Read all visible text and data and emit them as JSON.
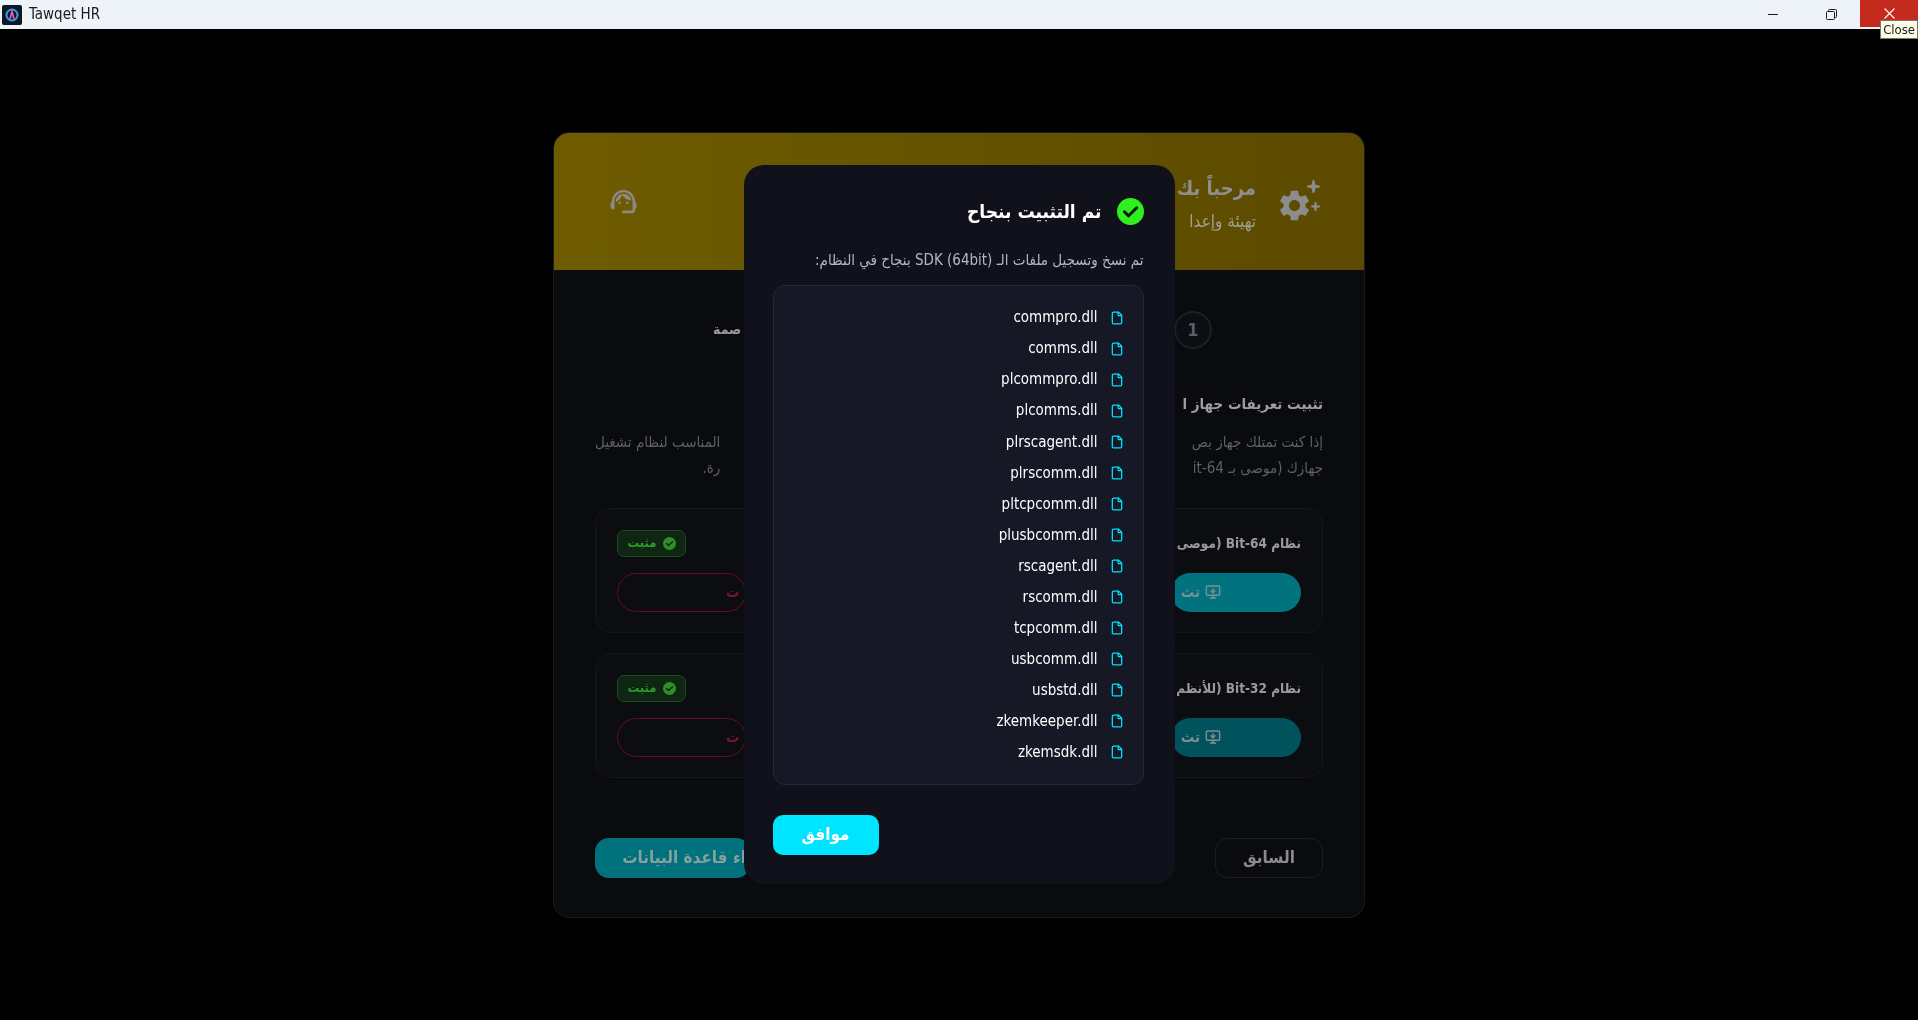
{
  "window": {
    "title": "Tawqet HR",
    "close_tooltip": "Close"
  },
  "header": {
    "title": "مرحباً بك",
    "subtitle": "تهيئة وإعدا"
  },
  "stepper": {
    "step_number": "1",
    "step_label": "صمة"
  },
  "section": {
    "title": "تثبيت تعريفات جهاز ا",
    "description_right_lines": [
      "إذا كنت تمتلك جهاز بص",
      "جهازك (موصى بـ 64-it"
    ],
    "description_left_lines": [
      "المناسب لنظام تشغيل",
      "رة."
    ]
  },
  "driver_cards": [
    {
      "title": "نظام **64-Bit** (موصى",
      "installed": true,
      "status_badge": "مثبت",
      "install_button": {
        "label": "تث",
        "disabled": false
      },
      "uninstall_button": "ت"
    },
    {
      "title": "نظام **32-Bit** (للأنظم",
      "installed": true,
      "status_badge": "مثبت",
      "install_button": {
        "label": "تث",
        "disabled": true
      },
      "uninstall_button": "ت"
    }
  ],
  "footer": {
    "create_database_button": "اء قاعدة البيانات",
    "back_button": "السابق"
  },
  "dialog": {
    "title": "تم التثبيت بنجاح",
    "message": "تم نسخ وتسجيل ملفات الـ SDK (64bit) بنجاح في النظام:",
    "files": [
      "commpro.dll",
      "comms.dll",
      "plcommpro.dll",
      "plcomms.dll",
      "plrscagent.dll",
      "plrscomm.dll",
      "pltcpcomm.dll",
      "plusbcomm.dll",
      "rscagent.dll",
      "rscomm.dll",
      "tcpcomm.dll",
      "usbcomm.dll",
      "usbstd.dll",
      "zkemkeeper.dll",
      "zkemsdk.dll"
    ],
    "ok_button": "موافق"
  }
}
